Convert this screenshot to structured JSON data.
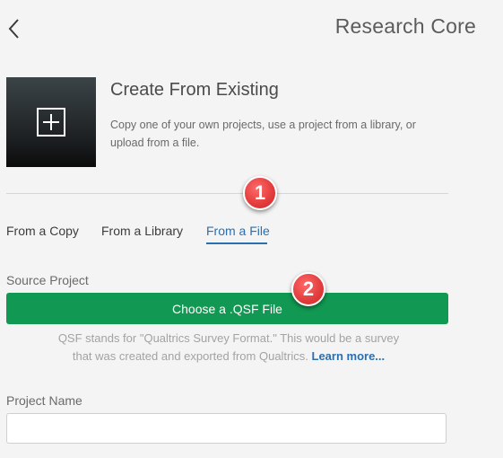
{
  "header": {
    "product_title": "Research Core"
  },
  "option": {
    "title": "Create From Existing",
    "description": "Copy one of your own projects, use a project from a library, or upload from a file."
  },
  "tabs": [
    {
      "label": "From a Copy",
      "active": false
    },
    {
      "label": "From a Library",
      "active": false
    },
    {
      "label": "From a File",
      "active": true
    }
  ],
  "source": {
    "label": "Source Project",
    "button_label": "Choose a .QSF File",
    "help_text": "QSF stands for \"Qualtrics Survey Format.\" This would be a survey that was created and exported from Qualtrics.",
    "help_link": "Learn more..."
  },
  "project_name": {
    "label": "Project Name",
    "value": "",
    "placeholder": ""
  },
  "markers": [
    "1",
    "2"
  ],
  "colors": {
    "accent_green": "#119852",
    "link_blue": "#2a6fb0",
    "marker_red": "#e23b3b"
  },
  "icons": {
    "back": "chevron-left-icon",
    "create": "plus-square-icon"
  }
}
